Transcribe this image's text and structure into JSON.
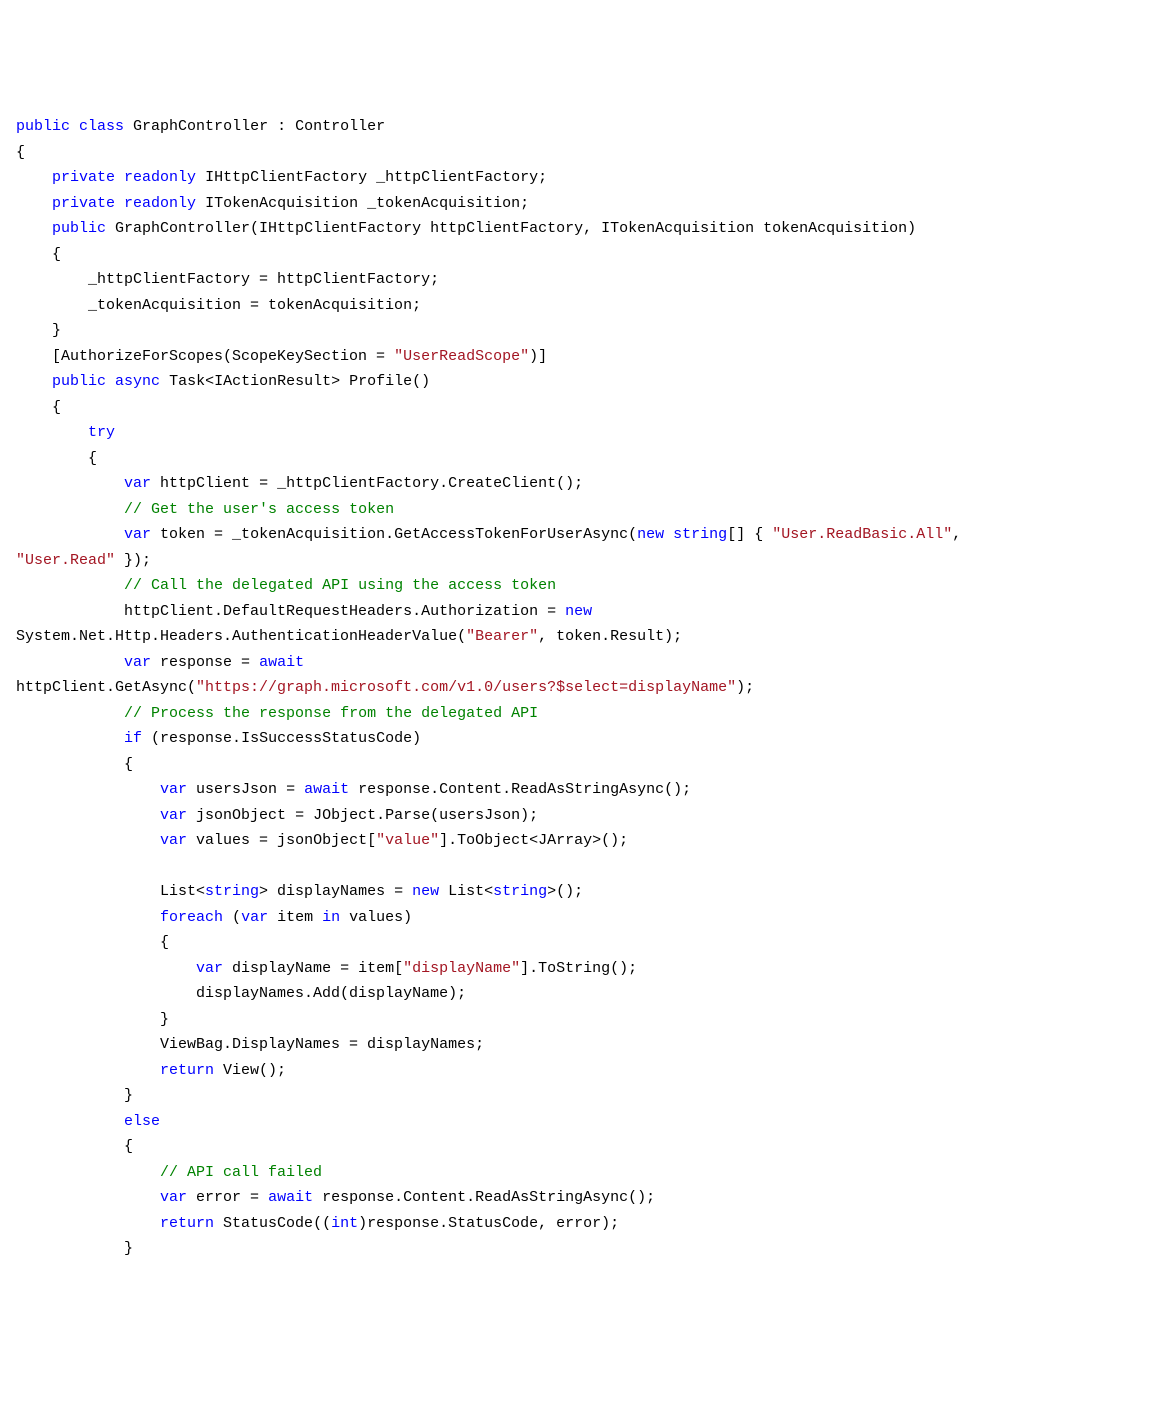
{
  "code": {
    "tokens": [
      {
        "t": "public",
        "c": "kw"
      },
      {
        "t": " ",
        "c": ""
      },
      {
        "t": "class",
        "c": "kw"
      },
      {
        "t": " GraphController : Controller\n",
        "c": ""
      },
      {
        "t": "{\n",
        "c": ""
      },
      {
        "t": "    ",
        "c": ""
      },
      {
        "t": "private",
        "c": "kw"
      },
      {
        "t": " ",
        "c": ""
      },
      {
        "t": "readonly",
        "c": "kw"
      },
      {
        "t": " IHttpClientFactory _httpClientFactory;\n",
        "c": ""
      },
      {
        "t": "    ",
        "c": ""
      },
      {
        "t": "private",
        "c": "kw"
      },
      {
        "t": " ",
        "c": ""
      },
      {
        "t": "readonly",
        "c": "kw"
      },
      {
        "t": " ITokenAcquisition _tokenAcquisition;\n",
        "c": ""
      },
      {
        "t": "    ",
        "c": ""
      },
      {
        "t": "public",
        "c": "kw"
      },
      {
        "t": " GraphController(IHttpClientFactory httpClientFactory, ITokenAcquisition tokenAcquisition)\n",
        "c": ""
      },
      {
        "t": "    {\n",
        "c": ""
      },
      {
        "t": "        _httpClientFactory = httpClientFactory;\n",
        "c": ""
      },
      {
        "t": "        _tokenAcquisition = tokenAcquisition;\n",
        "c": ""
      },
      {
        "t": "    }\n",
        "c": ""
      },
      {
        "t": "    [AuthorizeForScopes(ScopeKeySection = ",
        "c": ""
      },
      {
        "t": "\"UserReadScope\"",
        "c": "str"
      },
      {
        "t": ")]\n",
        "c": ""
      },
      {
        "t": "    ",
        "c": ""
      },
      {
        "t": "public",
        "c": "kw"
      },
      {
        "t": " ",
        "c": ""
      },
      {
        "t": "async",
        "c": "kw"
      },
      {
        "t": " Task<IActionResult> Profile()\n",
        "c": ""
      },
      {
        "t": "    {\n",
        "c": ""
      },
      {
        "t": "        ",
        "c": ""
      },
      {
        "t": "try",
        "c": "kw"
      },
      {
        "t": "\n",
        "c": ""
      },
      {
        "t": "        {\n",
        "c": ""
      },
      {
        "t": "            ",
        "c": ""
      },
      {
        "t": "var",
        "c": "kw"
      },
      {
        "t": " httpClient = _httpClientFactory.CreateClient();\n",
        "c": ""
      },
      {
        "t": "            ",
        "c": ""
      },
      {
        "t": "// Get the user's access token",
        "c": "cmt"
      },
      {
        "t": "\n",
        "c": ""
      },
      {
        "t": "            ",
        "c": ""
      },
      {
        "t": "var",
        "c": "kw"
      },
      {
        "t": " token = _tokenAcquisition.GetAccessTokenForUserAsync(",
        "c": ""
      },
      {
        "t": "new",
        "c": "kw"
      },
      {
        "t": " ",
        "c": ""
      },
      {
        "t": "string",
        "c": "kw"
      },
      {
        "t": "[] { ",
        "c": ""
      },
      {
        "t": "\"User.ReadBasic.All\"",
        "c": "str"
      },
      {
        "t": ", \n",
        "c": ""
      },
      {
        "t": "\"User.Read\"",
        "c": "str"
      },
      {
        "t": " });\n",
        "c": ""
      },
      {
        "t": "            ",
        "c": ""
      },
      {
        "t": "// Call the delegated API using the access token",
        "c": "cmt"
      },
      {
        "t": "\n",
        "c": ""
      },
      {
        "t": "            httpClient.DefaultRequestHeaders.Authorization = ",
        "c": ""
      },
      {
        "t": "new",
        "c": "kw"
      },
      {
        "t": " \n",
        "c": ""
      },
      {
        "t": "System.Net.Http.Headers.AuthenticationHeaderValue(",
        "c": ""
      },
      {
        "t": "\"Bearer\"",
        "c": "str"
      },
      {
        "t": ", token.Result);\n",
        "c": ""
      },
      {
        "t": "            ",
        "c": ""
      },
      {
        "t": "var",
        "c": "kw"
      },
      {
        "t": " response = ",
        "c": ""
      },
      {
        "t": "await",
        "c": "kw"
      },
      {
        "t": " \n",
        "c": ""
      },
      {
        "t": "httpClient.GetAsync(",
        "c": ""
      },
      {
        "t": "\"https://graph.microsoft.com/v1.0/users?$select=displayName\"",
        "c": "str"
      },
      {
        "t": ");\n",
        "c": ""
      },
      {
        "t": "            ",
        "c": ""
      },
      {
        "t": "// Process the response from the delegated API",
        "c": "cmt"
      },
      {
        "t": "\n",
        "c": ""
      },
      {
        "t": "            ",
        "c": ""
      },
      {
        "t": "if",
        "c": "kw"
      },
      {
        "t": " (response.IsSuccessStatusCode)\n",
        "c": ""
      },
      {
        "t": "            {\n",
        "c": ""
      },
      {
        "t": "                ",
        "c": ""
      },
      {
        "t": "var",
        "c": "kw"
      },
      {
        "t": " usersJson = ",
        "c": ""
      },
      {
        "t": "await",
        "c": "kw"
      },
      {
        "t": " response.Content.ReadAsStringAsync();\n",
        "c": ""
      },
      {
        "t": "                ",
        "c": ""
      },
      {
        "t": "var",
        "c": "kw"
      },
      {
        "t": " jsonObject = JObject.Parse(usersJson);\n",
        "c": ""
      },
      {
        "t": "                ",
        "c": ""
      },
      {
        "t": "var",
        "c": "kw"
      },
      {
        "t": " values = jsonObject[",
        "c": ""
      },
      {
        "t": "\"value\"",
        "c": "str"
      },
      {
        "t": "].ToObject<JArray>();\n",
        "c": ""
      },
      {
        "t": "\n",
        "c": ""
      },
      {
        "t": "                List<",
        "c": ""
      },
      {
        "t": "string",
        "c": "kw"
      },
      {
        "t": "> displayNames = ",
        "c": ""
      },
      {
        "t": "new",
        "c": "kw"
      },
      {
        "t": " List<",
        "c": ""
      },
      {
        "t": "string",
        "c": "kw"
      },
      {
        "t": ">();\n",
        "c": ""
      },
      {
        "t": "                ",
        "c": ""
      },
      {
        "t": "foreach",
        "c": "kw"
      },
      {
        "t": " (",
        "c": ""
      },
      {
        "t": "var",
        "c": "kw"
      },
      {
        "t": " item ",
        "c": ""
      },
      {
        "t": "in",
        "c": "kw"
      },
      {
        "t": " values)\n",
        "c": ""
      },
      {
        "t": "                {\n",
        "c": ""
      },
      {
        "t": "                    ",
        "c": ""
      },
      {
        "t": "var",
        "c": "kw"
      },
      {
        "t": " displayName = item[",
        "c": ""
      },
      {
        "t": "\"displayName\"",
        "c": "str"
      },
      {
        "t": "].ToString();\n",
        "c": ""
      },
      {
        "t": "                    displayNames.Add(displayName);\n",
        "c": ""
      },
      {
        "t": "                }\n",
        "c": ""
      },
      {
        "t": "                ViewBag.DisplayNames = displayNames;\n",
        "c": ""
      },
      {
        "t": "                ",
        "c": ""
      },
      {
        "t": "return",
        "c": "kw"
      },
      {
        "t": " View();\n",
        "c": ""
      },
      {
        "t": "            }\n",
        "c": ""
      },
      {
        "t": "            ",
        "c": ""
      },
      {
        "t": "else",
        "c": "kw"
      },
      {
        "t": "\n",
        "c": ""
      },
      {
        "t": "            {\n",
        "c": ""
      },
      {
        "t": "                ",
        "c": ""
      },
      {
        "t": "// API call failed",
        "c": "cmt"
      },
      {
        "t": "\n",
        "c": ""
      },
      {
        "t": "                ",
        "c": ""
      },
      {
        "t": "var",
        "c": "kw"
      },
      {
        "t": " error = ",
        "c": ""
      },
      {
        "t": "await",
        "c": "kw"
      },
      {
        "t": " response.Content.ReadAsStringAsync();\n",
        "c": ""
      },
      {
        "t": "                ",
        "c": ""
      },
      {
        "t": "return",
        "c": "kw"
      },
      {
        "t": " StatusCode((",
        "c": ""
      },
      {
        "t": "int",
        "c": "kw"
      },
      {
        "t": ")response.StatusCode, error);\n",
        "c": ""
      },
      {
        "t": "            }\n",
        "c": ""
      }
    ]
  }
}
